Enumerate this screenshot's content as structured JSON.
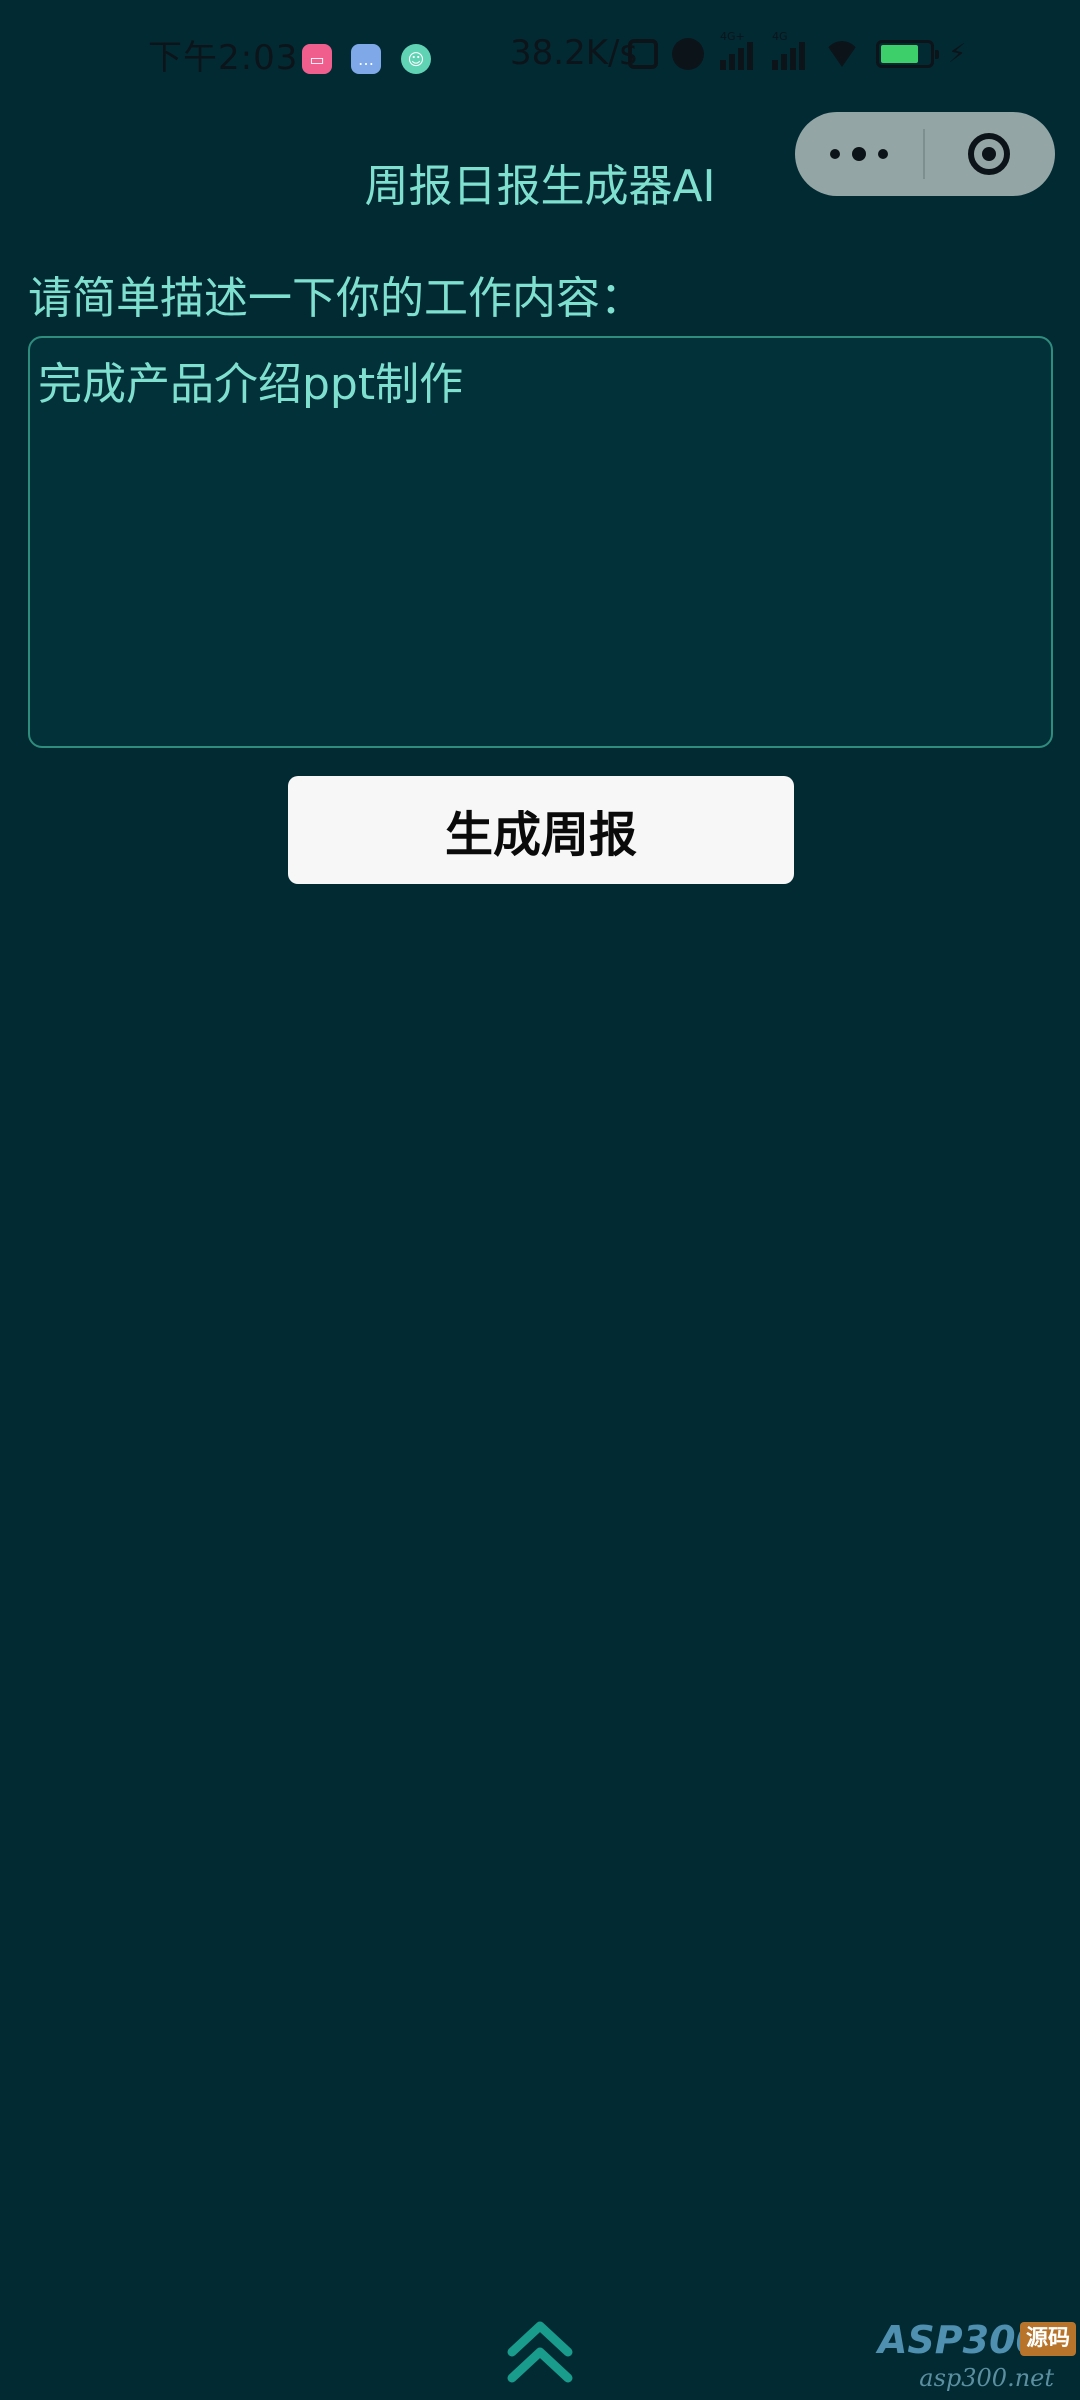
{
  "status_bar": {
    "time": "下午2:03",
    "network_speed": "38.2K/s",
    "signal_tag_1": "4G+",
    "signal_tag_2": "4G",
    "battery_percent": 77,
    "notification_icons": [
      "bilibili-icon",
      "message-icon",
      "assistant-icon"
    ]
  },
  "capsule": {
    "more_icon": "more-dots-icon",
    "close_icon": "target-close-icon"
  },
  "header": {
    "title": "周报日报生成器AI"
  },
  "form": {
    "prompt_label": "请简单描述一下你的工作内容：",
    "work_description": "完成产品介绍ppt制作",
    "generate_button_label": "生成周报"
  },
  "footer": {
    "scroll_up_icon": "double-chevron-up-icon"
  },
  "watermark": {
    "brand": "ASP300",
    "tag": "源码",
    "url": "asp300.net"
  },
  "colors": {
    "background": "#022a33",
    "accent_text": "#7fe0cf",
    "input_border": "#2f8d7d",
    "button_bg": "#f7f7f7"
  }
}
